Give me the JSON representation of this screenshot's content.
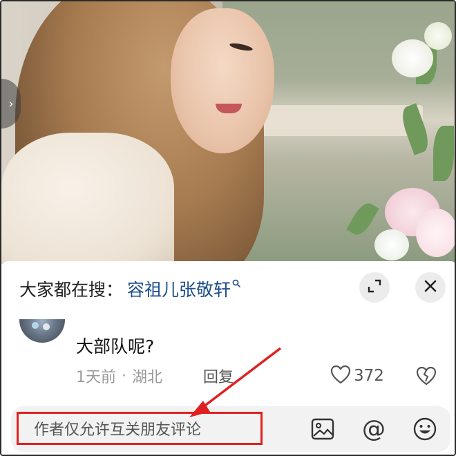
{
  "search": {
    "prefix": "大家都在搜：",
    "term": "容祖儿张敬轩",
    "search_glyph": "search-icon"
  },
  "header_buttons": {
    "expand_icon": "expand-icon",
    "close_icon": "close-icon"
  },
  "comment": {
    "text": "大部队呢?",
    "time": "1天前",
    "separator": "·",
    "location": "湖北",
    "reply_label": "回复",
    "like_count": "372"
  },
  "input_bar": {
    "placeholder": "作者仅允许互关朋友评论",
    "icons": [
      "image-icon",
      "at-icon",
      "emoji-icon"
    ],
    "at_glyph": "@"
  },
  "colors": {
    "accent_link": "#1f4e8c",
    "annotation_red": "#e02020",
    "panel_bg": "#ffffff",
    "input_bg": "#f2f2f2"
  }
}
